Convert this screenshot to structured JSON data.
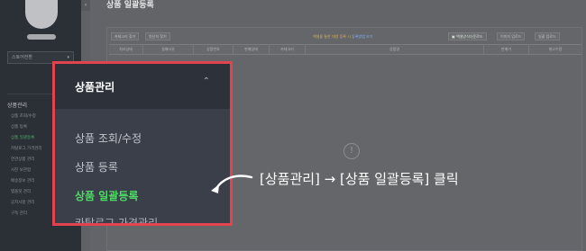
{
  "sidebar": {
    "store_select": "스토어전환",
    "section_title": "상품관리",
    "items": [
      {
        "label": "상품 조회/수정",
        "active": false
      },
      {
        "label": "상품 등록",
        "active": false
      },
      {
        "label": "상품 일괄등록",
        "active": true
      },
      {
        "label": "카탈로그 가격관리",
        "active": false
      },
      {
        "label": "연관상품 관리",
        "active": false
      },
      {
        "label": "사진 보관함",
        "active": false
      },
      {
        "label": "배송정보 관리",
        "active": false
      },
      {
        "label": "템플릿 관리",
        "active": false
      },
      {
        "label": "공지사항 관리",
        "active": false
      },
      {
        "label": "구독 관리",
        "active": false
      }
    ]
  },
  "page": {
    "title": "상품 일괄등록"
  },
  "toolbar": {
    "buttons": [
      "카테고리 찾기",
      "원산지 찾기"
    ],
    "notice": "엑셀을 통한 대량 등록 시",
    "notice_link": "등록방법 보기",
    "excel_button": "엑셀양식다운로드",
    "upload_buttons": [
      "이미지 업로드",
      "일괄 업로드"
    ]
  },
  "grid": {
    "columns": [
      "처리상태",
      "실패사유",
      "상품번호",
      "판매상태",
      "카테고리",
      "상품명",
      "판매가",
      "재고수량"
    ]
  },
  "callout": {
    "title": "상품관리",
    "items": [
      {
        "label": "상품 조회/수정",
        "active": false
      },
      {
        "label": "상품 등록",
        "active": false
      },
      {
        "label": "상품 일괄등록",
        "active": true
      },
      {
        "label": "카탈로그 가격관리",
        "active": false
      }
    ]
  },
  "annotation": {
    "instruction": "[상품관리] → [상품 일괄등록] 클릭"
  },
  "colors": {
    "highlight_border": "#e2434f",
    "active_menu": "#4ddc64",
    "sidebar_bg": "#2b2f36"
  }
}
